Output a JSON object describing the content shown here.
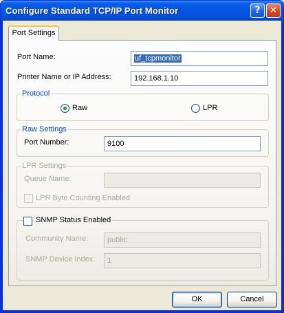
{
  "window": {
    "title": "Configure Standard TCP/IP Port Monitor",
    "help_glyph": "?",
    "close_glyph": "✕"
  },
  "tabs": [
    {
      "label": "Port Settings",
      "selected": true
    }
  ],
  "port_name": {
    "label": "Port Name:",
    "value": "uf_tcpmonitor"
  },
  "printer_address": {
    "label": "Printer Name or IP Address:",
    "value": "192.168.1.10"
  },
  "protocol": {
    "title": "Protocol",
    "options": [
      {
        "label": "Raw",
        "selected": true
      },
      {
        "label": "LPR",
        "selected": false
      }
    ]
  },
  "raw_settings": {
    "title": "Raw Settings",
    "port_number_label": "Port Number:",
    "port_number_value": "9100"
  },
  "lpr_settings": {
    "title": "LPR Settings",
    "queue_name_label": "Queue Name:",
    "queue_name_value": "",
    "byte_counting_label": "LPR Byte Counting Enabled",
    "byte_counting_checked": false
  },
  "snmp": {
    "enabled_label": "SNMP Status Enabled",
    "enabled_checked": false,
    "community_label": "Community Name:",
    "community_value": "public",
    "device_index_label": "SNMP Device Index:",
    "device_index_value": "1"
  },
  "buttons": {
    "ok": "OK",
    "cancel": "Cancel"
  },
  "colors": {
    "title_bar": "#0554e3",
    "group_title": "#0046d5",
    "selection": "#316ac5",
    "dialog_bg": "#ece9d8"
  }
}
